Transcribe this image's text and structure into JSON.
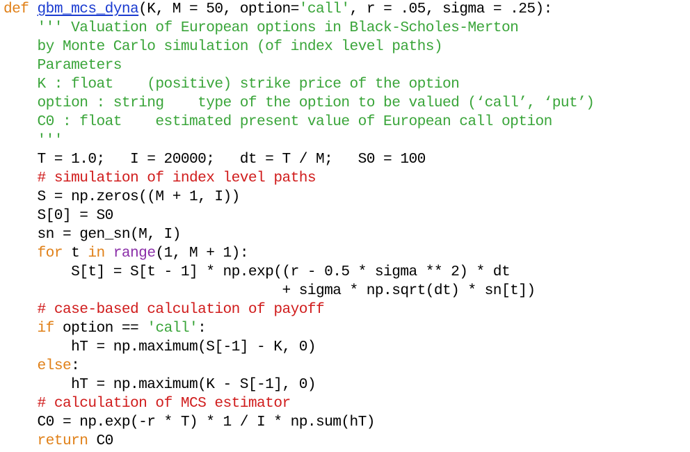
{
  "colors": {
    "keyword": "#e08018",
    "function_name": "#1a3bd0",
    "string": "#3aa53a",
    "docstring": "#3aa53a",
    "comment": "#d01c1c",
    "builtin": "#8a2ea8",
    "plain": "#000000",
    "background": "#ffffff"
  },
  "code": {
    "lines": [
      [
        {
          "t": "def",
          "c": "keyword"
        },
        {
          "t": " ",
          "c": "plain"
        },
        {
          "t": "gbm_mcs_dyna",
          "c": "fn"
        },
        {
          "t": "(K, M = 50, option=",
          "c": "plain"
        },
        {
          "t": "'call'",
          "c": "string"
        },
        {
          "t": ", r = .05, sigma = .25):",
          "c": "plain"
        }
      ],
      [
        {
          "t": "    ''' Valuation of European options in Black-Scholes-Merton",
          "c": "doc"
        }
      ],
      [
        {
          "t": "    by Monte Carlo simulation (of index level paths)",
          "c": "doc"
        }
      ],
      [
        {
          "t": "    Parameters",
          "c": "doc"
        }
      ],
      [
        {
          "t": "    K : float    (positive) strike price of the option",
          "c": "doc"
        }
      ],
      [
        {
          "t": "    option : string    type of the option to be valued (‘call’, ‘put’)",
          "c": "doc"
        }
      ],
      [
        {
          "t": "    C0 : float    estimated present value of European call option",
          "c": "doc"
        }
      ],
      [
        {
          "t": "    '''",
          "c": "doc"
        }
      ],
      [
        {
          "t": "    T = 1.0;   I = 20000;   dt = T / M;   S0 = 100",
          "c": "plain"
        }
      ],
      [
        {
          "t": "    ",
          "c": "plain"
        },
        {
          "t": "# simulation of index level paths",
          "c": "comment"
        }
      ],
      [
        {
          "t": "    S = np.zeros((M + 1, I))",
          "c": "plain"
        }
      ],
      [
        {
          "t": "    S[0] = S0",
          "c": "plain"
        }
      ],
      [
        {
          "t": "    sn = gen_sn(M, I)",
          "c": "plain"
        }
      ],
      [
        {
          "t": "    ",
          "c": "plain"
        },
        {
          "t": "for",
          "c": "keyword"
        },
        {
          "t": " t ",
          "c": "plain"
        },
        {
          "t": "in",
          "c": "keyword"
        },
        {
          "t": " ",
          "c": "plain"
        },
        {
          "t": "range",
          "c": "builtin"
        },
        {
          "t": "(1, M + 1):",
          "c": "plain"
        }
      ],
      [
        {
          "t": "        S[t] = S[t - 1] * np.exp((r - 0.5 * sigma ** 2) * dt",
          "c": "plain"
        }
      ],
      [
        {
          "t": "                                 + sigma * np.sqrt(dt) * sn[t])",
          "c": "plain"
        }
      ],
      [
        {
          "t": "    ",
          "c": "plain"
        },
        {
          "t": "# case-based calculation of payoff",
          "c": "comment"
        }
      ],
      [
        {
          "t": "    ",
          "c": "plain"
        },
        {
          "t": "if",
          "c": "keyword"
        },
        {
          "t": " option == ",
          "c": "plain"
        },
        {
          "t": "'call'",
          "c": "string"
        },
        {
          "t": ":",
          "c": "plain"
        }
      ],
      [
        {
          "t": "        hT = np.maximum(S[-1] - K, 0)",
          "c": "plain"
        }
      ],
      [
        {
          "t": "    ",
          "c": "plain"
        },
        {
          "t": "else",
          "c": "keyword"
        },
        {
          "t": ":",
          "c": "plain"
        }
      ],
      [
        {
          "t": "        hT = np.maximum(K - S[-1], 0)",
          "c": "plain"
        }
      ],
      [
        {
          "t": "    ",
          "c": "plain"
        },
        {
          "t": "# calculation of MCS estimator",
          "c": "comment"
        }
      ],
      [
        {
          "t": "    C0 = np.exp(-r * T) * 1 / I * np.sum(hT)",
          "c": "plain"
        }
      ],
      [
        {
          "t": "    ",
          "c": "plain"
        },
        {
          "t": "return",
          "c": "keyword"
        },
        {
          "t": " C0",
          "c": "plain"
        }
      ]
    ]
  }
}
